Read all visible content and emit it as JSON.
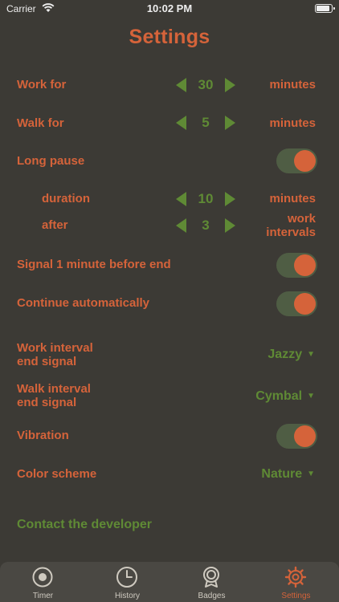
{
  "status_bar": {
    "carrier": "Carrier",
    "time": "10:02 PM"
  },
  "page": {
    "title": "Settings"
  },
  "work": {
    "label": "Work for",
    "value": "30",
    "unit": "minutes"
  },
  "walk": {
    "label": "Walk for",
    "value": "5",
    "unit": "minutes"
  },
  "long_pause": {
    "label": "Long pause",
    "enabled": true
  },
  "duration": {
    "label": "duration",
    "value": "10",
    "unit": "minutes"
  },
  "after": {
    "label": "after",
    "value": "3",
    "unit_line1": "work",
    "unit_line2": "intervals"
  },
  "signal_before_end": {
    "label": "Signal 1 minute before end",
    "enabled": true
  },
  "continue_auto": {
    "label": "Continue automatically",
    "enabled": true
  },
  "work_end_signal": {
    "label_line1": "Work interval",
    "label_line2": "end signal",
    "value": "Jazzy"
  },
  "walk_end_signal": {
    "label_line1": "Walk interval",
    "label_line2": "end signal",
    "value": "Cymbal"
  },
  "vibration": {
    "label": "Vibration",
    "enabled": true
  },
  "color_scheme": {
    "label": "Color scheme",
    "value": "Nature"
  },
  "contact": {
    "label": "Contact the developer"
  },
  "tabs": [
    {
      "label": "Timer",
      "icon": "timer-icon"
    },
    {
      "label": "History",
      "icon": "clock-icon"
    },
    {
      "label": "Badges",
      "icon": "badge-icon"
    },
    {
      "label": "Settings",
      "icon": "gear-icon",
      "active": true
    }
  ],
  "colors": {
    "background": "#3c3a35",
    "accent": "#d5633a",
    "green": "#5f8a35",
    "toggle_track": "#4f5d44"
  }
}
